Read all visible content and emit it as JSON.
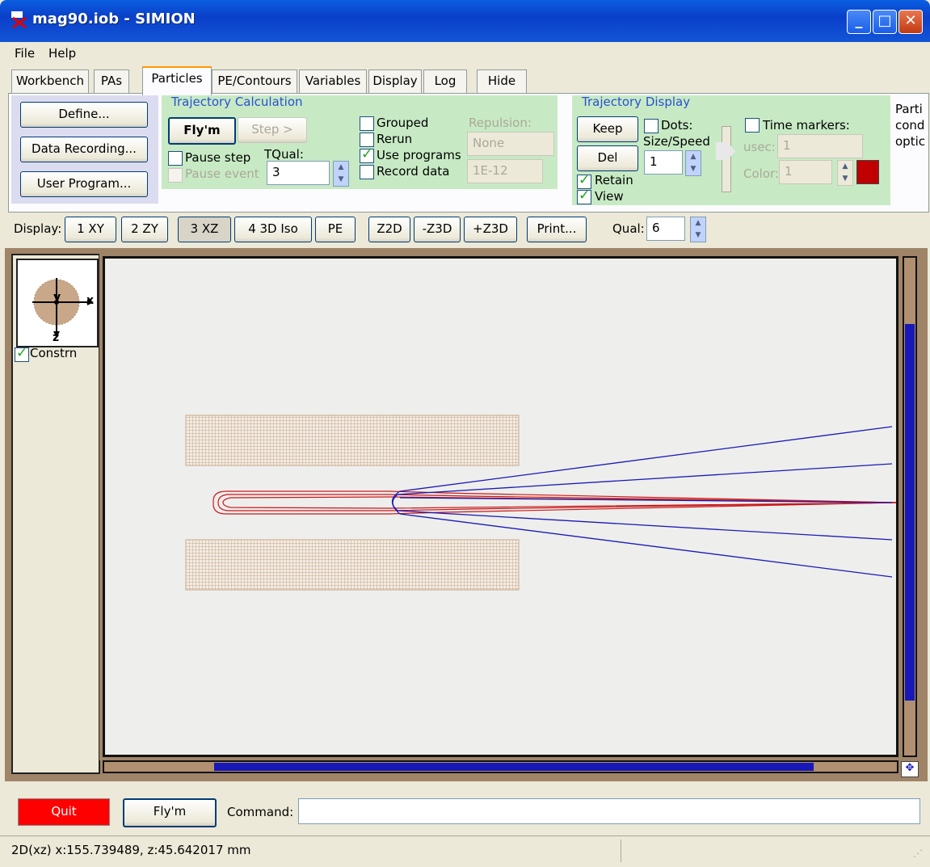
{
  "window": {
    "title": "mag90.iob - SIMION"
  },
  "menu": [
    "File",
    "Help"
  ],
  "tabs": [
    "Workbench",
    "PAs",
    "Particles",
    "PE/Contours",
    "Variables",
    "Display",
    "Log",
    "Hide"
  ],
  "active_tab": "Particles",
  "particles_panel": {
    "define_label": "Define...",
    "data_recording_label": "Data Recording...",
    "user_program_label": "User Program...",
    "trajectory_calc": {
      "title": "Trajectory Calculation",
      "flym_label": "Fly'm",
      "step_label": "Step >",
      "pause_step_label": "Pause step",
      "pause_event_label": "Pause event",
      "tqual_label": "TQual:",
      "tqual_value": "3",
      "grouped_label": "Grouped",
      "rerun_label": "Rerun",
      "use_programs_label": "Use programs",
      "record_data_label": "Record data",
      "repulsion_label": "Repulsion:",
      "repulsion_value": "None",
      "repulsion_amount": "1E-12"
    },
    "trajectory_display": {
      "title": "Trajectory Display",
      "keep_label": "Keep",
      "del_label": "Del",
      "dots_label": "Dots:",
      "size_speed_label": "Size/Speed",
      "size_speed_value": "1",
      "retain_label": "Retain",
      "view_label": "View",
      "time_markers_label": "Time markers:",
      "usec_label": "usec:",
      "usec_value": "1",
      "color_label": "Color:",
      "color_value": "1",
      "marker_color": "#c00000"
    },
    "side_text": [
      "Parti",
      "cond",
      "optic"
    ]
  },
  "display_bar": {
    "label": "Display:",
    "buttons": [
      "1 XY",
      "2 ZY",
      "3 XZ",
      "4 3D Iso",
      "PE",
      "Z2D",
      "-Z3D",
      "+Z3D",
      "Print..."
    ],
    "qual_label": "Qual:",
    "qual_value": "6"
  },
  "view": {
    "axis_x": "x",
    "axis_y": "y",
    "axis_z": "z",
    "constrain_label": "Constrn"
  },
  "bottom": {
    "quit_label": "Quit",
    "flym_label": "Fly'm",
    "command_label": "Command:",
    "command_value": ""
  },
  "status": {
    "text": "2D(xz) x:155.739489, z:45.642017 mm"
  },
  "colors": {
    "trajectory_red": "#c81818",
    "trajectory_blue": "#1a1ab4",
    "electrode": "#c8a888",
    "quit_bg": "#ff0000"
  }
}
